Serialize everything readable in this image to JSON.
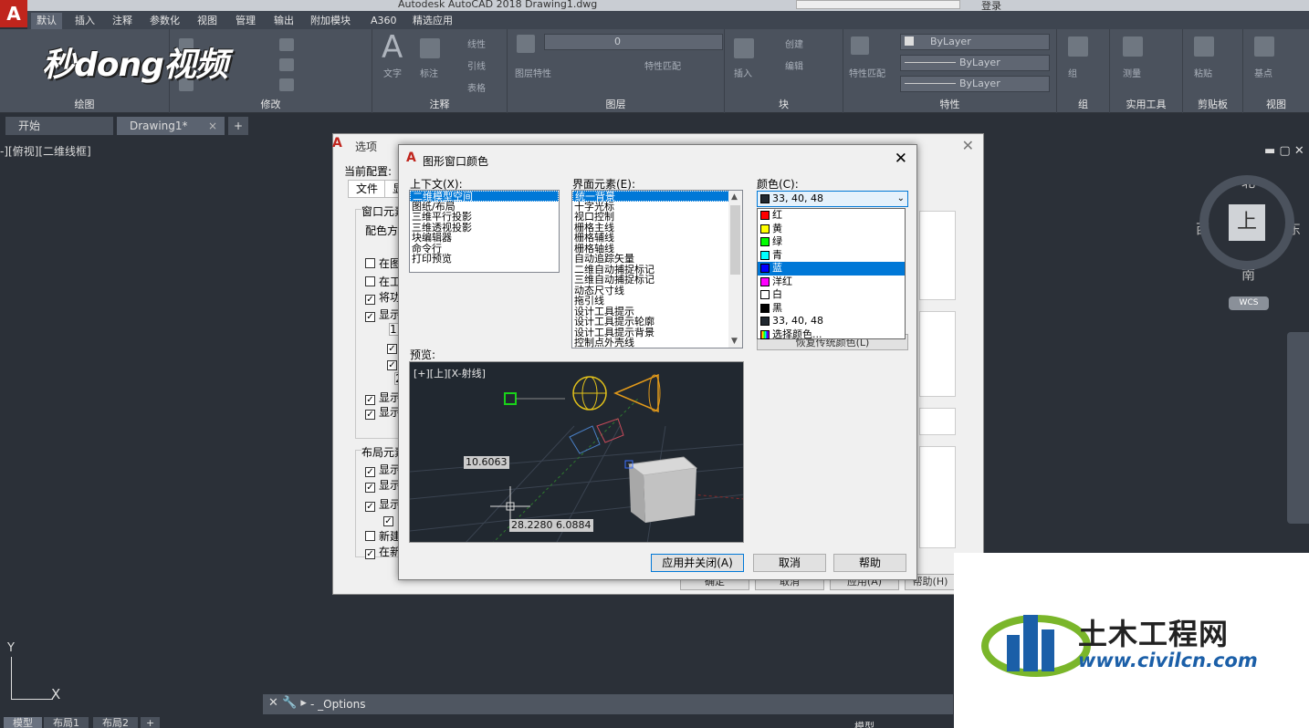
{
  "app": {
    "title": "Autodesk AutoCAD 2018    Drawing1.dwg",
    "logo_letter": "A",
    "login": "登录"
  },
  "ribbon_tabs": [
    "默认",
    "插入",
    "注释",
    "参数化",
    "视图",
    "管理",
    "输出",
    "附加模块",
    "A360",
    "精选应用"
  ],
  "ribbon_groups": [
    "绘图",
    "修改",
    "注释",
    "图层",
    "块",
    "特性",
    "组",
    "实用工具",
    "剪贴板",
    "视图"
  ],
  "ribbon": {
    "layer_combo": "0",
    "bylayer_1": "ByLayer",
    "bylayer_2": "ByLayer",
    "bylayer_3": "ByLayer",
    "text_label": "文字",
    "annot_label": "标注",
    "line_label": "线性",
    "leader_label": "引线",
    "table_label": "表格",
    "insert_label": "插入",
    "create_label": "创建",
    "edit_label": "编辑",
    "layer_prop_label": "图层特性",
    "match_label": "特性匹配",
    "group_label": "组",
    "measure_label": "测量",
    "paste_label": "粘贴",
    "base_label": "基点"
  },
  "watermark_top": "秒dong视频",
  "doc_tabs": [
    "开始",
    "Drawing1*"
  ],
  "viewport_label": "-][俯视][二维线框]",
  "compass": {
    "north": "北",
    "south": "南",
    "east": "东",
    "west": "西",
    "top": "上",
    "wcs": "WCS"
  },
  "ucs": {
    "x": "X",
    "y": "Y"
  },
  "cmdline": {
    "text": "- _Options"
  },
  "layout_tabs": [
    "模型",
    "布局1",
    "布局2"
  ],
  "status": {
    "model": "模型"
  },
  "options_dialog": {
    "title": "选项",
    "profile_label": "当前配置:",
    "tabs": [
      "文件",
      "显"
    ],
    "window_elements": "窗口元素",
    "color_scheme": "配色方案",
    "checks": [
      {
        "label": "在图",
        "checked": false
      },
      {
        "label": "在工",
        "checked": false
      },
      {
        "label": "将功",
        "checked": true
      },
      {
        "label": "显示",
        "checked": true
      }
    ],
    "sub_value": "1.",
    "checks2": [
      {
        "label": "显示",
        "checked": true
      },
      {
        "label": "显示",
        "checked": true
      }
    ],
    "layout_elements": "布局元素",
    "checks3": [
      {
        "label": "显示",
        "checked": true
      },
      {
        "label": "显示",
        "checked": true
      },
      {
        "label": "显示",
        "checked": true
      },
      {
        "label": "",
        "checked": true
      },
      {
        "label": "新建",
        "checked": false
      },
      {
        "label": "在新",
        "checked": true
      }
    ],
    "sub_value2": "2",
    "buttons": [
      "确定",
      "取消",
      "应用(A)",
      "帮助(H)"
    ]
  },
  "color_dialog": {
    "title": "图形窗口颜色",
    "context_label": "上下文(X):",
    "contexts": [
      "二维模型空间",
      "图纸/布局",
      "三维平行投影",
      "三维透视投影",
      "块编辑器",
      "命令行",
      "打印预览"
    ],
    "selected_context": 0,
    "element_label": "界面元素(E):",
    "elements": [
      "统一背景",
      "十字光标",
      "视口控制",
      "栅格主线",
      "栅格辅线",
      "栅格轴线",
      "自动追踪矢量",
      "二维自动捕捉标记",
      "三维自动捕捉标记",
      "动态尺寸线",
      "拖引线",
      "设计工具提示",
      "设计工具提示轮廓",
      "设计工具提示背景",
      "控制点外壳线"
    ],
    "selected_element": 0,
    "color_label": "颜色(C):",
    "current_color": "33, 40, 48",
    "current_color_hex": "#212830",
    "color_options": [
      {
        "name": "红",
        "hex": "#ff0000"
      },
      {
        "name": "黄",
        "hex": "#ffff00"
      },
      {
        "name": "绿",
        "hex": "#00ff00"
      },
      {
        "name": "青",
        "hex": "#00ffff"
      },
      {
        "name": "蓝",
        "hex": "#0000ff"
      },
      {
        "name": "洋红",
        "hex": "#ff00ff"
      },
      {
        "name": "白",
        "hex": "#ffffff"
      },
      {
        "name": "黑",
        "hex": "#000000"
      },
      {
        "name": "33, 40, 48",
        "hex": "#212830"
      },
      {
        "name": "选择颜色...",
        "hex": "#ffffff"
      }
    ],
    "highlighted_color": 4,
    "restore_button": "恢复传统颜色(L)",
    "preview_label": "预览:",
    "preview_viewport": "[+][上][X-射线]",
    "dims": [
      "10.6063",
      "28.2280",
      "6.0884"
    ],
    "buttons": {
      "apply_close": "应用并关闭(A)",
      "cancel": "取消",
      "help": "帮助"
    }
  },
  "watermark_bottom": {
    "brand": "土木工程网",
    "url": "www.civilcn.com"
  }
}
